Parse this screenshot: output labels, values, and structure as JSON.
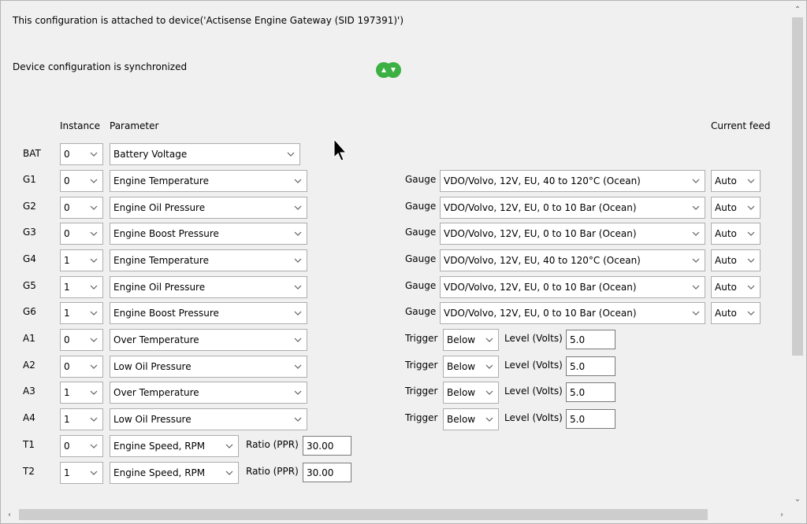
{
  "header": {
    "attached_text": "This configuration is attached to device('Actisense Engine Gateway (SID 197391)')",
    "sync_text": "Device configuration is synchronized",
    "sync_icon": "sync-icon",
    "sync_color": "#3cb043"
  },
  "columns": {
    "instance": "Instance",
    "parameter": "Parameter",
    "current_feed": "Current feed"
  },
  "bat": {
    "label": "BAT",
    "instance": "0",
    "parameter": "Battery Voltage"
  },
  "gauges": [
    {
      "label": "G1",
      "instance": "0",
      "parameter": "Engine Temperature",
      "gauge_label": "Gauge",
      "gauge": "VDO/Volvo, 12V, EU, 40 to 120°C (Ocean)",
      "feed": "Auto"
    },
    {
      "label": "G2",
      "instance": "0",
      "parameter": "Engine Oil Pressure",
      "gauge_label": "Gauge",
      "gauge": "VDO/Volvo, 12V, EU, 0 to 10 Bar (Ocean)",
      "feed": "Auto"
    },
    {
      "label": "G3",
      "instance": "0",
      "parameter": "Engine Boost Pressure",
      "gauge_label": "Gauge",
      "gauge": "VDO/Volvo, 12V, EU, 0 to 10 Bar (Ocean)",
      "feed": "Auto"
    },
    {
      "label": "G4",
      "instance": "1",
      "parameter": "Engine Temperature",
      "gauge_label": "Gauge",
      "gauge": "VDO/Volvo, 12V, EU, 40 to 120°C (Ocean)",
      "feed": "Auto"
    },
    {
      "label": "G5",
      "instance": "1",
      "parameter": "Engine Oil Pressure",
      "gauge_label": "Gauge",
      "gauge": "VDO/Volvo, 12V, EU, 0 to 10 Bar (Ocean)",
      "feed": "Auto"
    },
    {
      "label": "G6",
      "instance": "1",
      "parameter": "Engine Boost Pressure",
      "gauge_label": "Gauge",
      "gauge": "VDO/Volvo, 12V, EU, 0 to 10 Bar (Ocean)",
      "feed": "Auto"
    }
  ],
  "alarms": [
    {
      "label": "A1",
      "instance": "0",
      "parameter": "Over Temperature",
      "trigger_label": "Trigger",
      "trigger": "Below",
      "level_label": "Level (Volts)",
      "level": "5.0"
    },
    {
      "label": "A2",
      "instance": "0",
      "parameter": "Low Oil Pressure",
      "trigger_label": "Trigger",
      "trigger": "Below",
      "level_label": "Level (Volts)",
      "level": "5.0"
    },
    {
      "label": "A3",
      "instance": "1",
      "parameter": "Over Temperature",
      "trigger_label": "Trigger",
      "trigger": "Below",
      "level_label": "Level (Volts)",
      "level": "5.0"
    },
    {
      "label": "A4",
      "instance": "1",
      "parameter": "Low Oil Pressure",
      "trigger_label": "Trigger",
      "trigger": "Below",
      "level_label": "Level (Volts)",
      "level": "5.0"
    }
  ],
  "tachos": [
    {
      "label": "T1",
      "instance": "0",
      "parameter": "Engine Speed, RPM",
      "ratio_label": "Ratio (PPR)",
      "ratio": "30.00"
    },
    {
      "label": "T2",
      "instance": "1",
      "parameter": "Engine Speed, RPM",
      "ratio_label": "Ratio (PPR)",
      "ratio": "30.00"
    }
  ]
}
